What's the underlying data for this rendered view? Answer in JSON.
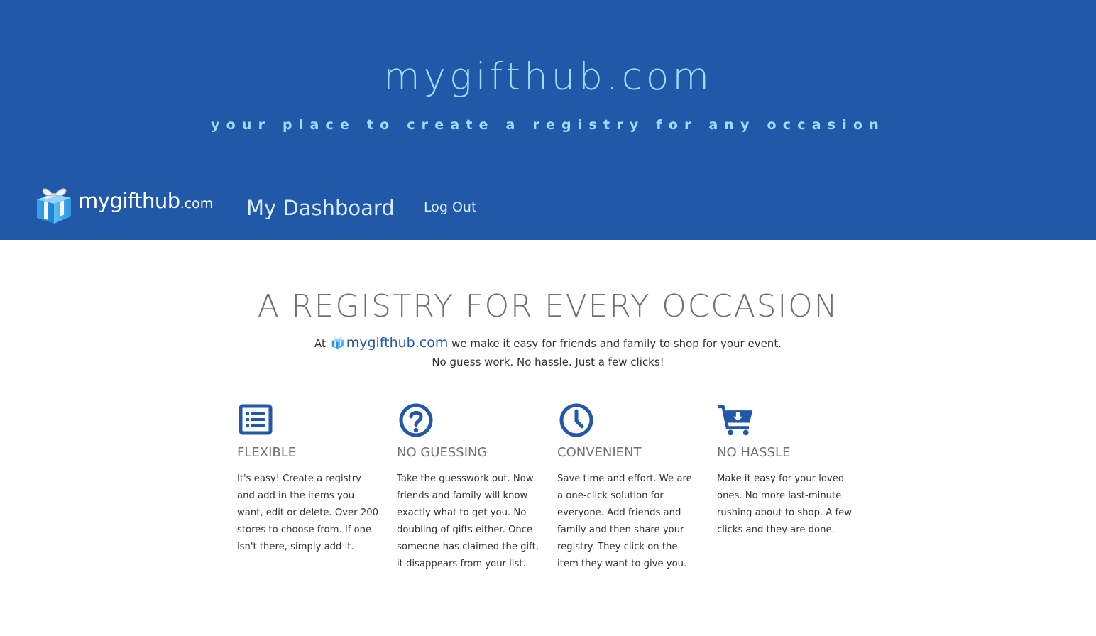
{
  "header": {
    "site_title": "mygifthub.com",
    "tagline": "your place to create a registry for any occasion",
    "background_color": "#2159a8",
    "title_color": "#9fdcff"
  },
  "nav": {
    "logo": {
      "icon": "gift-box-icon",
      "brand_name": "mygifthub",
      "brand_tld": ".com"
    },
    "items": [
      {
        "label": "My Dashboard"
      },
      {
        "label": "Log Out"
      }
    ]
  },
  "hero": {
    "heading": "A REGISTRY FOR EVERY OCCASION",
    "intro_prefix": "At",
    "intro_brand": "mygifthub.com",
    "intro_suffix": "we make it easy for friends and family to shop for your event.",
    "intro_line2": "No guess work. No hassle. Just a few clicks!"
  },
  "features": [
    {
      "icon": "list-icon",
      "title": "FLEXIBLE",
      "text": "It's easy! Create a registry and add in the items you want, edit or delete. Over 200 stores to choose from. If one isn't there, simply add it."
    },
    {
      "icon": "question-circle-icon",
      "title": "NO GUESSING",
      "text": "Take the guesswork out. Now friends and family will know exactly what to get you. No doubling of gifts either. Once someone has claimed the gift, it disappears from your list."
    },
    {
      "icon": "clock-icon",
      "title": "CONVENIENT",
      "text": "Save time and effort. We are a one-click solution for everyone. Add friends and family and then share your registry. They click on the item they want to give you."
    },
    {
      "icon": "cart-download-icon",
      "title": "NO HASSLE",
      "text": "Make it easy for your loved ones. No more last-minute rushing about to shop. A few clicks and they are done."
    }
  ],
  "colors": {
    "accent": "#2159a8",
    "heading_gray": "#707070",
    "body_text": "#333333"
  }
}
